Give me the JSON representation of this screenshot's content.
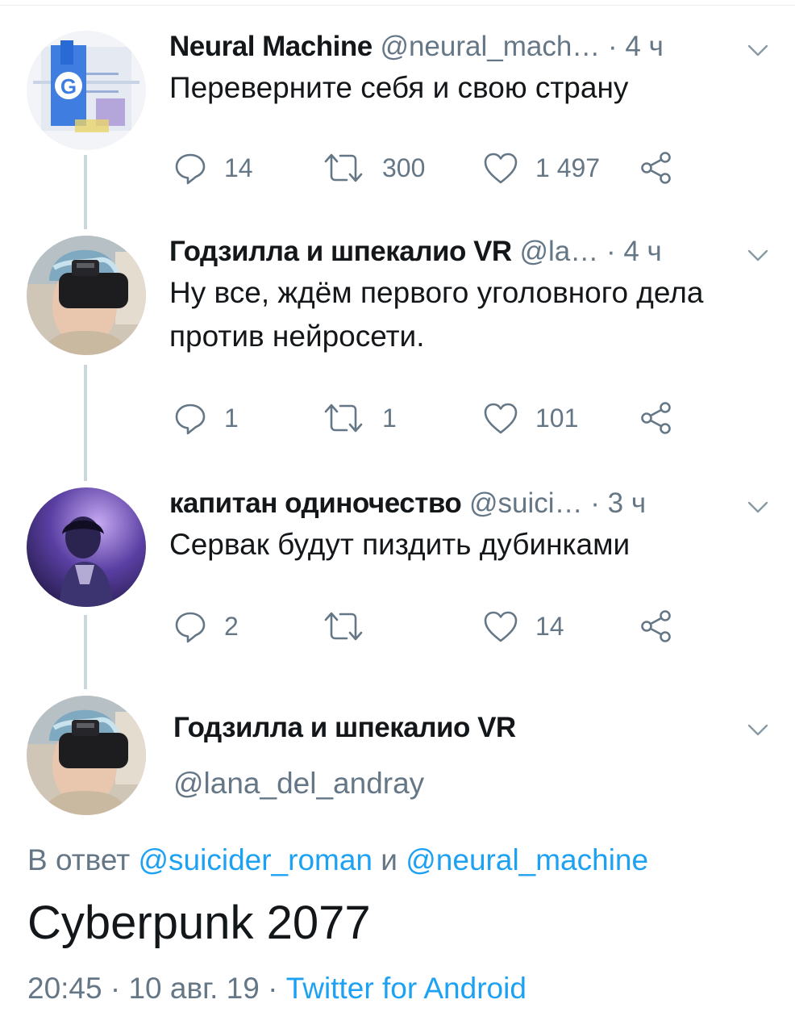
{
  "thread": [
    {
      "name": "Neural Machine",
      "handle": "@neural_mach…",
      "time": "· 4 ч",
      "text": "Переверните себя и свою страну",
      "replies": "14",
      "retweets": "300",
      "likes": "1 497"
    },
    {
      "name": "Годзилла и шпекалио VR",
      "handle": "@la…",
      "time": "· 4 ч",
      "text": "Ну все, ждём первого уголовного дела против нейросети.",
      "replies": "1",
      "retweets": "1",
      "likes": "101"
    },
    {
      "name": "капитан одиночество",
      "handle": "@suici…",
      "time": "· 3 ч",
      "text": "Сервак будут пиздить дубинками",
      "replies": "2",
      "retweets": "",
      "likes": "14"
    }
  ],
  "main_tweet": {
    "name": "Годзилла и шпекалио VR",
    "handle": "@lana_del_andray",
    "reply_prefix": "В ответ",
    "reply_user_1": "@suicider_roman",
    "reply_and": "и",
    "reply_user_2": "@neural_machine",
    "text": "Cyberpunk 2077",
    "timestamp": "20:45 · 10 авг. 19 ·",
    "source": "Twitter for Android"
  },
  "icons": {
    "reply": "reply-icon",
    "retweet": "retweet-icon",
    "like": "heart-icon",
    "share": "share-icon",
    "menu": "chevron-down-icon"
  },
  "colors": {
    "link": "#1da1f2",
    "secondary": "#657786",
    "thread_line": "#ccd6dd"
  }
}
